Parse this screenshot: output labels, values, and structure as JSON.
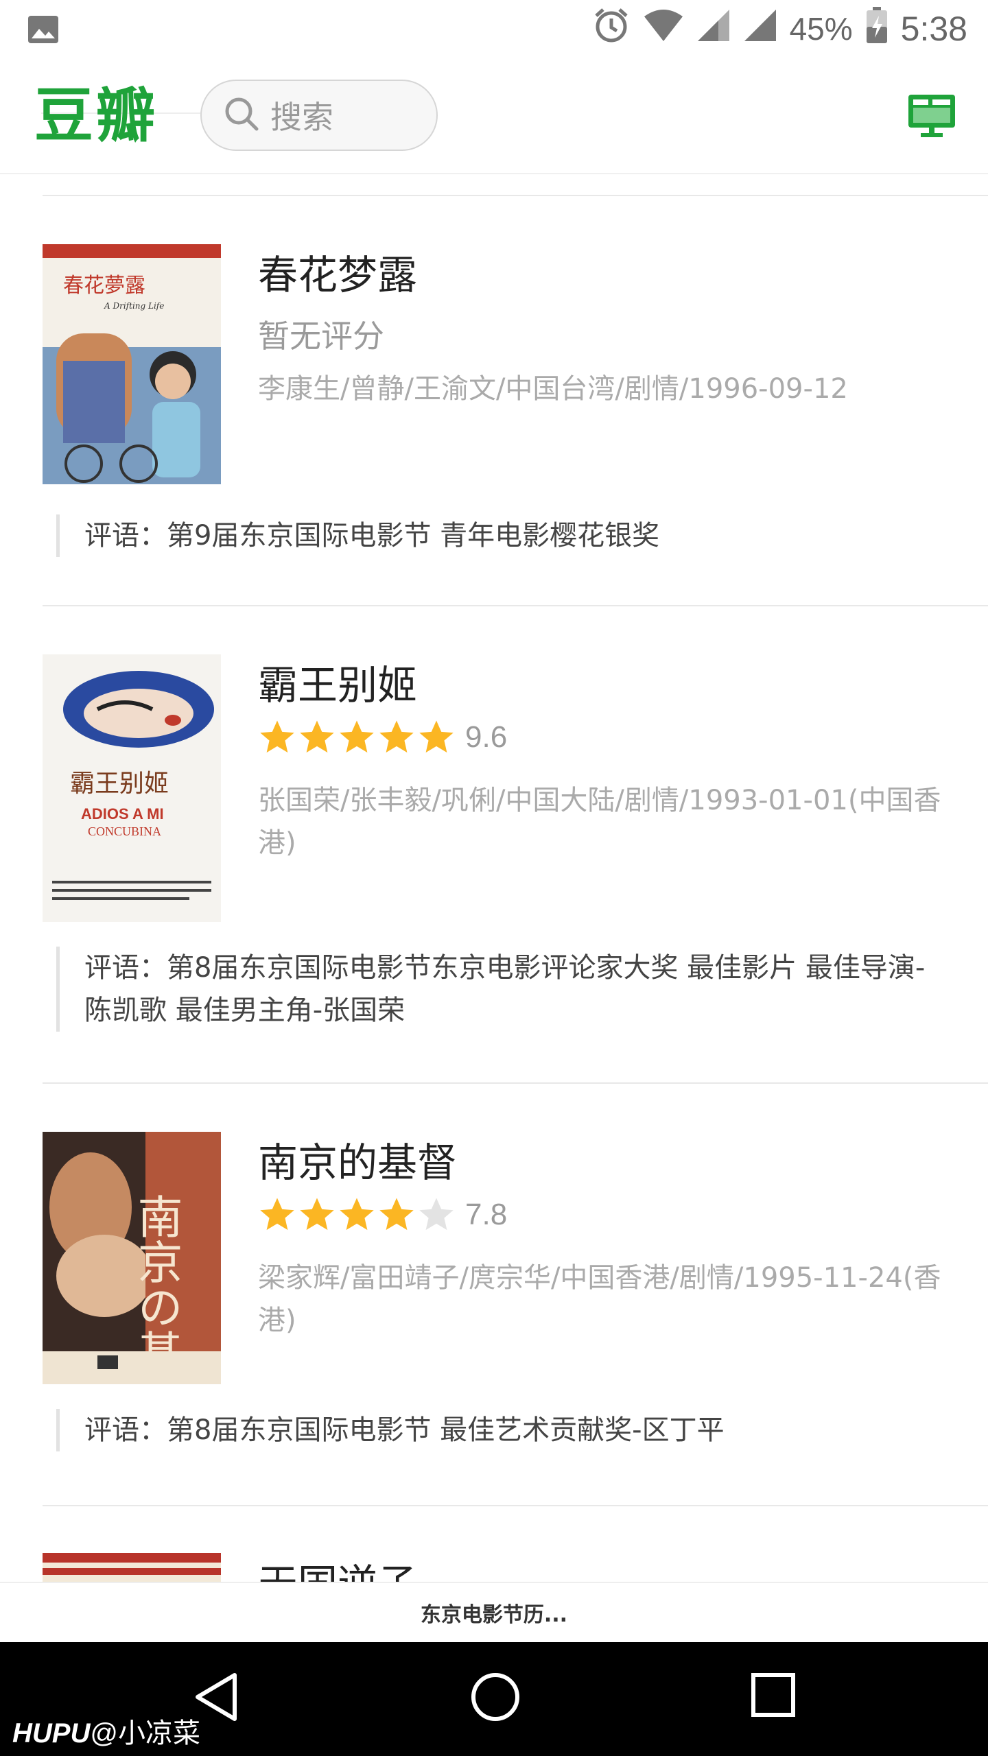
{
  "status_bar": {
    "battery": "45%",
    "time": "5:38",
    "icons": [
      "image-icon",
      "alarm-icon",
      "wifi-icon",
      "signal-icon",
      "signal-icon",
      "battery-charging-icon"
    ]
  },
  "header": {
    "brand": "豆瓣",
    "search_placeholder": "搜索",
    "accent": "#1fa33a"
  },
  "movies": [
    {
      "title": "春花梦露",
      "rating_text": "暂无评分",
      "meta": "李康生/曾静/王渝文/中国台湾/剧情/1996-09-12",
      "comment": "评语：第9届东京国际电影节 青年电影樱花银奖",
      "poster": {
        "title": "春花夢露",
        "subtitle": "A Drifting Life"
      }
    },
    {
      "title": "霸王别姬",
      "stars": 5,
      "score": "9.6",
      "meta": "张国荣/张丰毅/巩俐/中国大陆/剧情/1993-01-01(中国香港)",
      "comment": "评语：第8届东京国际电影节东京电影评论家大奖 最佳影片 最佳导演-陈凯歌 最佳男主角-张国荣",
      "poster": {
        "title": "霸王别姬",
        "subtitle": "ADIOS A MI",
        "subtitle2": "CONCUBINA"
      }
    },
    {
      "title": "南京的基督",
      "stars": 4,
      "score": "7.8",
      "meta": "梁家辉/富田靖子/庹宗华/中国香港/剧情/1995-11-24(香港)",
      "comment": "评语：第8届东京国际电影节 最佳艺术贡献奖-区丁平",
      "poster": {
        "title": "南京の基督"
      }
    },
    {
      "title": "天国逆子"
    }
  ],
  "bottom_bar": {
    "title": "东京电影节历..."
  },
  "watermark": {
    "brand": "HUPU",
    "user": "@小凉菜"
  },
  "colors": {
    "star": "#fbb623",
    "star_empty": "#e3e3e3",
    "meta_text": "#aaaaaa"
  }
}
